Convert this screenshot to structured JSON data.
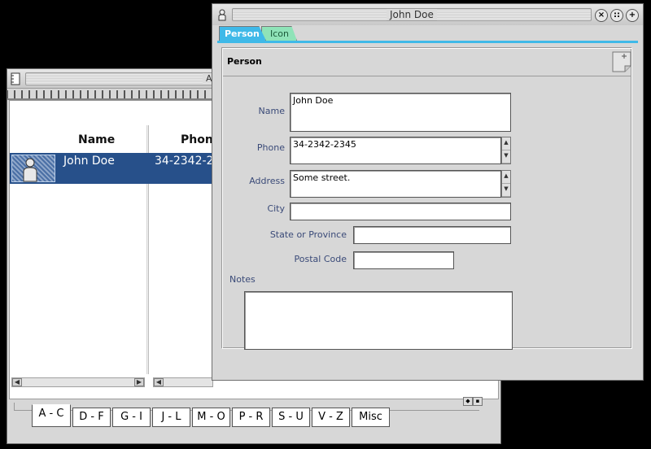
{
  "address_book": {
    "title_fragment": "A",
    "columns": {
      "name": "Name",
      "phone": "Phone"
    },
    "selected_row": {
      "name": "John Doe",
      "phone": "34-2342-2"
    },
    "alpha_tabs": [
      "A - C",
      "D - F",
      "G - I",
      "J - L",
      "M - O",
      "P - R",
      "S - U",
      "V - Z",
      "Misc"
    ],
    "active_tab": "A - C"
  },
  "contact_window": {
    "title": "John Doe",
    "view_tabs": [
      "Person",
      "Icon"
    ],
    "active_view": "Person",
    "section_title": "Person",
    "fields": {
      "name": {
        "label": "Name",
        "value": "John Doe"
      },
      "phone": {
        "label": "Phone",
        "value": "34-2342-2345"
      },
      "address": {
        "label": "Address",
        "value": "Some street."
      },
      "city": {
        "label": "City",
        "value": ""
      },
      "state": {
        "label": "State or Province",
        "value": ""
      },
      "postal": {
        "label": "Postal Code",
        "value": ""
      },
      "notes": {
        "label": "Notes",
        "value": ""
      }
    }
  },
  "colors": {
    "desktop": "#000000",
    "selection": "#27508a",
    "person_tab": "#3fb9e8",
    "icon_tab": "#8fe3b8",
    "field_label": "#3a4a78"
  }
}
